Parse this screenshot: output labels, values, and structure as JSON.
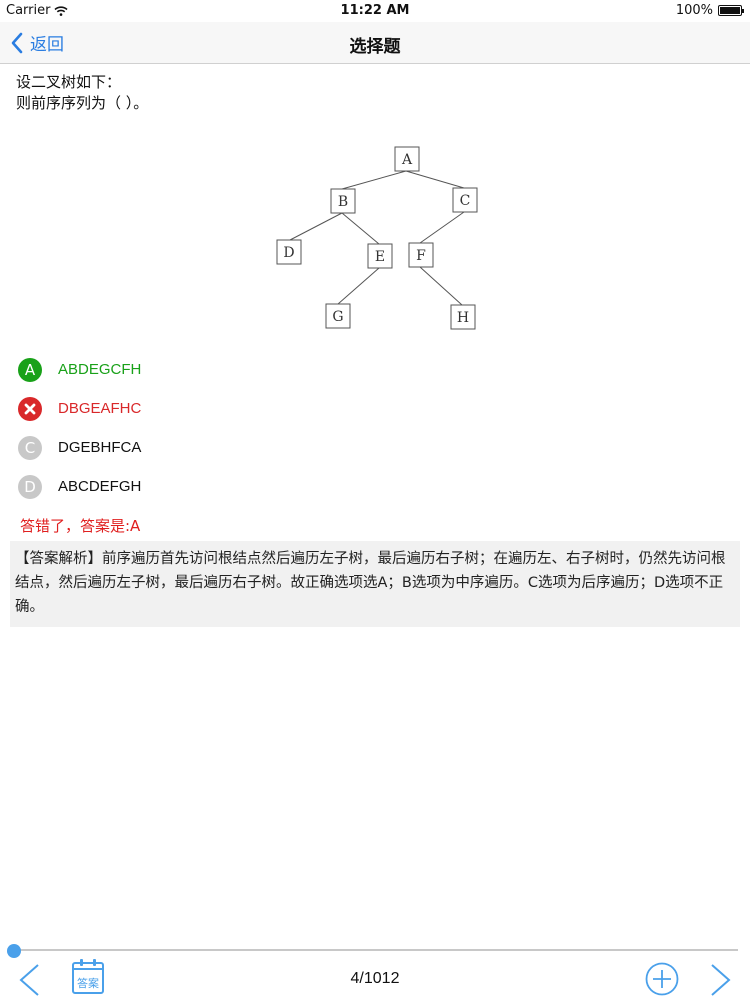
{
  "status": {
    "carrier": "Carrier",
    "time": "11:22 AM",
    "battery": "100%"
  },
  "nav": {
    "back_label": "返回",
    "title": "选择题"
  },
  "question": {
    "line1": "设二叉树如下：",
    "line2": "则前序序列为（  ）。"
  },
  "tree": {
    "nodes": [
      "A",
      "B",
      "C",
      "D",
      "E",
      "F",
      "G",
      "H"
    ],
    "edges": [
      [
        "A",
        "B"
      ],
      [
        "A",
        "C"
      ],
      [
        "B",
        "D"
      ],
      [
        "B",
        "E"
      ],
      [
        "C",
        "F"
      ],
      [
        "E",
        "G"
      ],
      [
        "F",
        "H"
      ]
    ]
  },
  "options": [
    {
      "letter": "A",
      "text": "ABDEGCFH",
      "state": "correct",
      "color": "#19a119"
    },
    {
      "letter": "B",
      "text": "DBGEAFHC",
      "state": "wrong",
      "color": "#d9282a"
    },
    {
      "letter": "C",
      "text": "DGEBHFCA",
      "state": "none",
      "color": "#c8c8c8"
    },
    {
      "letter": "D",
      "text": "ABCDEFGH",
      "state": "none",
      "color": "#c8c8c8"
    }
  ],
  "result_text": "答错了，答案是:A",
  "explanation": "【答案解析】前序遍历首先访问根结点然后遍历左子树，最后遍历右子树；在遍历左、右子树时，仍然先访问根结点，然后遍历左子树，最后遍历右子树。故正确选项选A；B选项为中序遍历。C选项为后序遍历；D选项不正确。",
  "progress": {
    "current": 4,
    "total": 1012
  },
  "toolbar": {
    "answer_label": "答案",
    "page_text": "4/1012"
  },
  "colors": {
    "accent": "#4aa0ea",
    "correct": "#19a119",
    "wrong": "#e02020",
    "nav_back": "#2a7de1"
  }
}
